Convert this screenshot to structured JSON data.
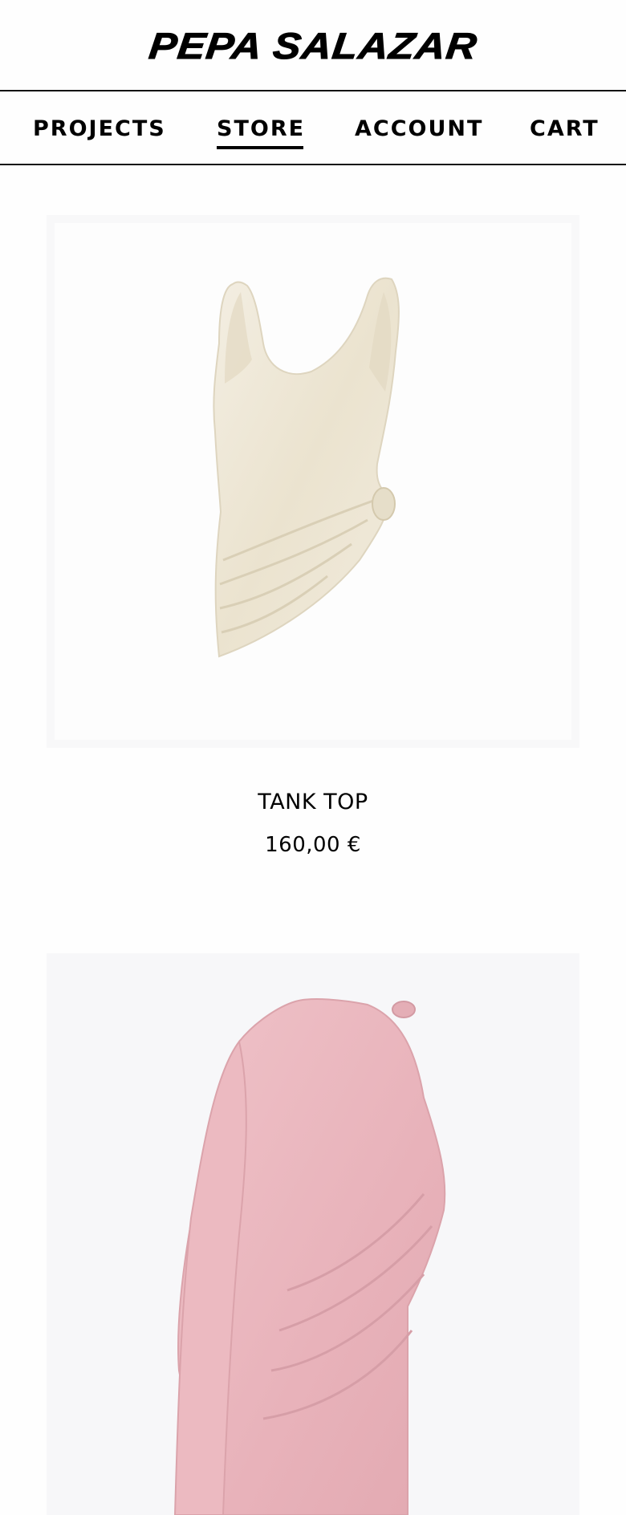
{
  "header": {
    "logo_text": "PEPA SALAZAR"
  },
  "nav": {
    "items": [
      {
        "label": "PROJECTS",
        "active": false
      },
      {
        "label": "STORE",
        "active": true
      },
      {
        "label": "ACCOUNT",
        "active": false
      },
      {
        "label": "CART",
        "active": false
      }
    ]
  },
  "products": [
    {
      "name": "TANK TOP",
      "price": "160,00 €",
      "image_color": "#efe9d9"
    },
    {
      "name": "",
      "price": "",
      "image_color": "#eab8bf"
    }
  ],
  "colors": {
    "background": "#fefefe",
    "text": "#000000",
    "image_background": "#f8f8f9"
  }
}
